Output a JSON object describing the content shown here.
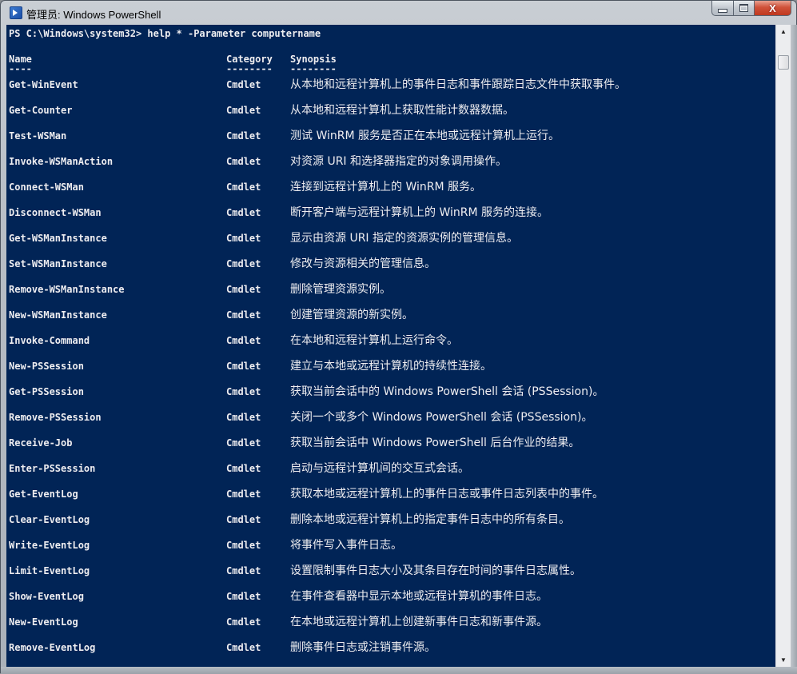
{
  "window": {
    "title": "管理员: Windows PowerShell",
    "app_icon": "powershell-icon",
    "buttons": {
      "minimize": "minimize-icon",
      "maximize": "maximize-icon",
      "close_label": "X"
    }
  },
  "console": {
    "colors": {
      "background": "#012456",
      "foreground": "#EEEDF0"
    },
    "prompt": "PS C:\\Windows\\system32> help * -Parameter computername",
    "headers": {
      "name": "Name",
      "category": "Category",
      "synopsis": "Synopsis"
    },
    "underlines": {
      "name": "----",
      "category": "--------",
      "synopsis": "--------"
    },
    "rows": [
      {
        "name": "Get-WinEvent",
        "category": "Cmdlet",
        "synopsis": "从本地和远程计算机上的事件日志和事件跟踪日志文件中获取事件。"
      },
      {
        "name": "Get-Counter",
        "category": "Cmdlet",
        "synopsis": "从本地和远程计算机上获取性能计数器数据。"
      },
      {
        "name": "Test-WSMan",
        "category": "Cmdlet",
        "synopsis": "测试 WinRM 服务是否正在本地或远程计算机上运行。"
      },
      {
        "name": "Invoke-WSManAction",
        "category": "Cmdlet",
        "synopsis": "对资源 URI 和选择器指定的对象调用操作。"
      },
      {
        "name": "Connect-WSMan",
        "category": "Cmdlet",
        "synopsis": "连接到远程计算机上的 WinRM 服务。"
      },
      {
        "name": "Disconnect-WSMan",
        "category": "Cmdlet",
        "synopsis": "断开客户端与远程计算机上的 WinRM 服务的连接。"
      },
      {
        "name": "Get-WSManInstance",
        "category": "Cmdlet",
        "synopsis": "显示由资源 URI 指定的资源实例的管理信息。"
      },
      {
        "name": "Set-WSManInstance",
        "category": "Cmdlet",
        "synopsis": "修改与资源相关的管理信息。"
      },
      {
        "name": "Remove-WSManInstance",
        "category": "Cmdlet",
        "synopsis": "删除管理资源实例。"
      },
      {
        "name": "New-WSManInstance",
        "category": "Cmdlet",
        "synopsis": "创建管理资源的新实例。"
      },
      {
        "name": "Invoke-Command",
        "category": "Cmdlet",
        "synopsis": "在本地和远程计算机上运行命令。"
      },
      {
        "name": "New-PSSession",
        "category": "Cmdlet",
        "synopsis": "建立与本地或远程计算机的持续性连接。"
      },
      {
        "name": "Get-PSSession",
        "category": "Cmdlet",
        "synopsis": "获取当前会话中的 Windows PowerShell 会话 (PSSession)。"
      },
      {
        "name": "Remove-PSSession",
        "category": "Cmdlet",
        "synopsis": "关闭一个或多个 Windows PowerShell 会话 (PSSession)。"
      },
      {
        "name": "Receive-Job",
        "category": "Cmdlet",
        "synopsis": "获取当前会话中 Windows PowerShell 后台作业的结果。"
      },
      {
        "name": "Enter-PSSession",
        "category": "Cmdlet",
        "synopsis": "启动与远程计算机间的交互式会话。"
      },
      {
        "name": "Get-EventLog",
        "category": "Cmdlet",
        "synopsis": "获取本地或远程计算机上的事件日志或事件日志列表中的事件。"
      },
      {
        "name": "Clear-EventLog",
        "category": "Cmdlet",
        "synopsis": "删除本地或远程计算机上的指定事件日志中的所有条目。"
      },
      {
        "name": "Write-EventLog",
        "category": "Cmdlet",
        "synopsis": "将事件写入事件日志。"
      },
      {
        "name": "Limit-EventLog",
        "category": "Cmdlet",
        "synopsis": "设置限制事件日志大小及其条目存在时间的事件日志属性。"
      },
      {
        "name": "Show-EventLog",
        "category": "Cmdlet",
        "synopsis": "在事件查看器中显示本地或远程计算机的事件日志。"
      },
      {
        "name": "New-EventLog",
        "category": "Cmdlet",
        "synopsis": "在本地或远程计算机上创建新事件日志和新事件源。"
      },
      {
        "name": "Remove-EventLog",
        "category": "Cmdlet",
        "synopsis": "删除事件日志或注销事件源。"
      }
    ]
  },
  "scrollbar": {
    "up_icon": "▲",
    "down_icon": "▼"
  }
}
